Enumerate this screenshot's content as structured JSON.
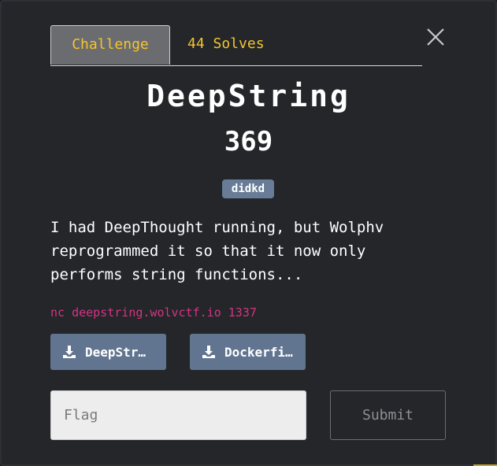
{
  "tabs": {
    "challenge_label": "Challenge",
    "solves_label": "44 Solves"
  },
  "challenge": {
    "name": "DeepString",
    "points": "369",
    "tag": "didkd",
    "description": "I had DeepThought running, but Wolphv\nreprogrammed it so that it now only\nperforms string functions...",
    "connection": "nc deepstring.wolvctf.io 1337"
  },
  "files": [
    {
      "label": "DeepStr…"
    },
    {
      "label": "Dockerfi…"
    }
  ],
  "form": {
    "flag_placeholder": "Flag",
    "submit_label": "Submit"
  },
  "icons": {
    "close": "close-icon",
    "download": "download-icon"
  },
  "colors": {
    "accent": "#f4c430",
    "tag_bg": "#687c97",
    "button_bg": "#627590",
    "connection_text": "#d63384",
    "modal_bg": "#24262a"
  }
}
